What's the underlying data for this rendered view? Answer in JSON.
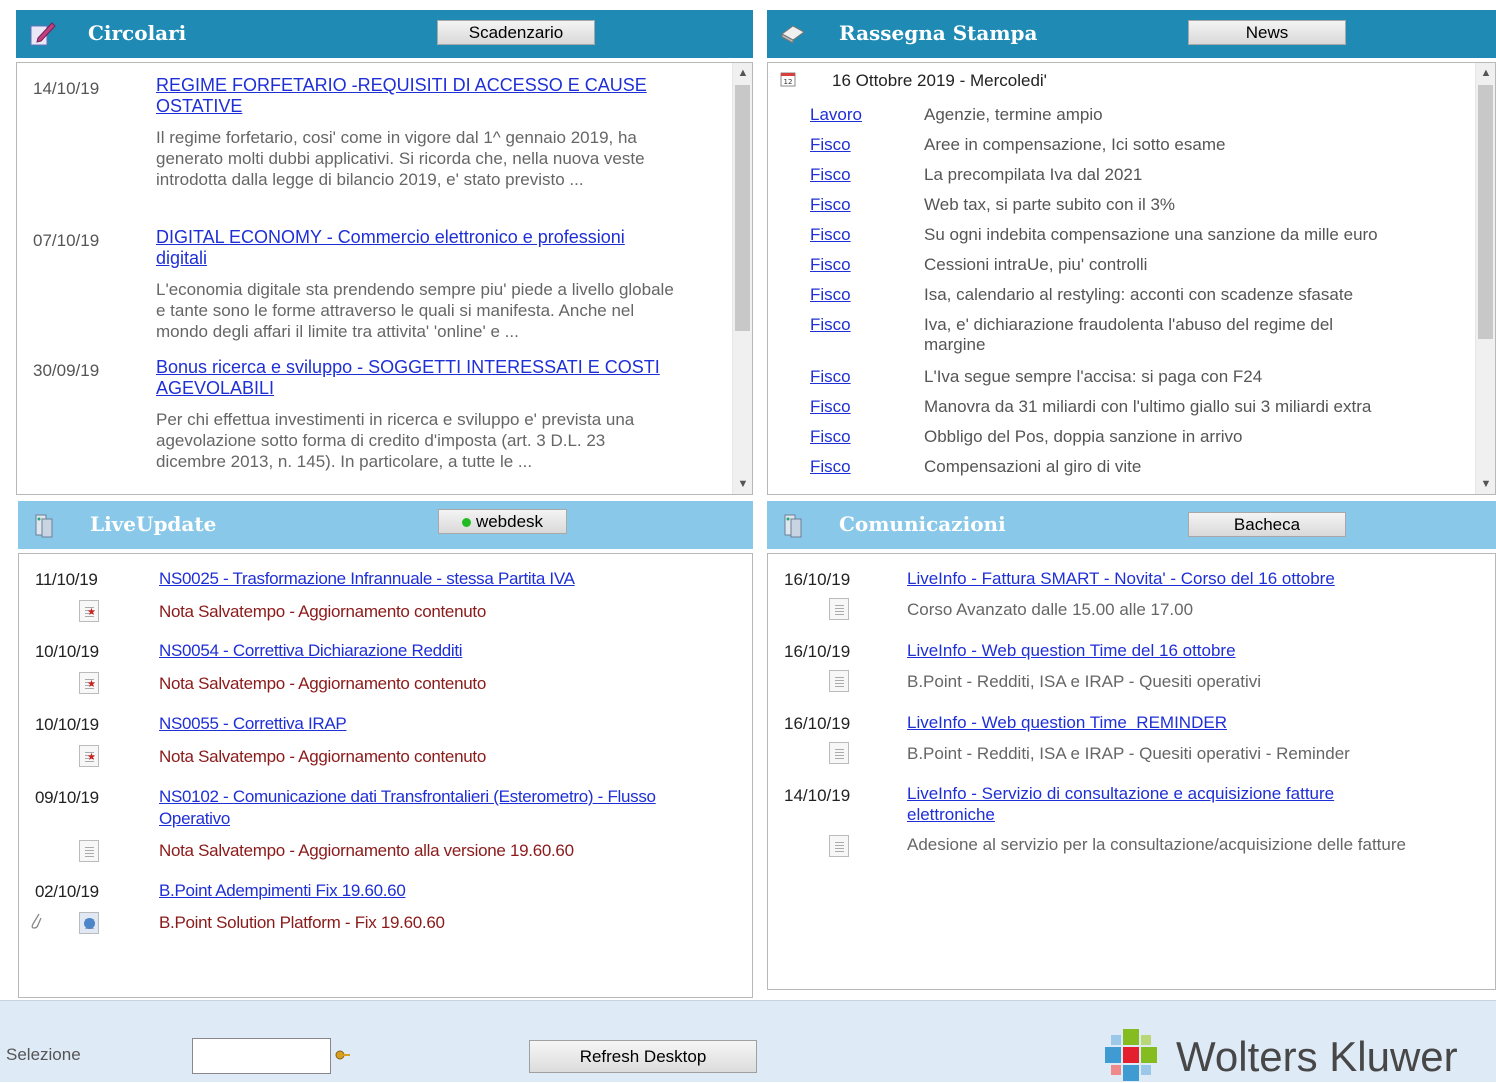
{
  "circolari": {
    "title": "Circolari",
    "button": "Scadenzario",
    "items": [
      {
        "date": "14/10/19",
        "title": "REGIME FORFETARIO -REQUISITI DI ACCESSO E CAUSE OSTATIVE",
        "desc": "Il regime forfetario, cosi' come in vigore dal 1^ gennaio 2019, ha generato molti dubbi applicativi. Si ricorda che, nella nuova veste introdotta dalla legge di bilancio 2019, e' stato previsto ..."
      },
      {
        "date": "07/10/19",
        "title": "DIGITAL ECONOMY - Commercio elettronico e professioni digitali",
        "desc": "L'economia digitale sta prendendo sempre piu' piede a livello globale e tante sono le forme attraverso le quali si manifesta. Anche nel mondo degli affari il limite tra attivita' 'online' e ..."
      },
      {
        "date": "30/09/19",
        "title": "Bonus ricerca e sviluppo - SOGGETTI INTERESSATI E COSTI AGEVOLABILI",
        "desc": "Per chi effettua investimenti in ricerca e sviluppo e' prevista una agevolazione sotto forma di credito d'imposta (art. 3 D.L. 23 dicembre 2013, n. 145). In particolare, a tutte le ..."
      }
    ]
  },
  "rassegna": {
    "title": "Rassegna Stampa",
    "button": "News",
    "date_heading": "16 Ottobre 2019 - Mercoledi'",
    "items": [
      {
        "cat": "Lavoro",
        "text": "Agenzie, termine ampio"
      },
      {
        "cat": "Fisco",
        "text": "Aree in compensazione, Ici sotto esame"
      },
      {
        "cat": "Fisco",
        "text": "La precompilata Iva dal 2021"
      },
      {
        "cat": "Fisco",
        "text": "Web tax, si parte subito con il 3%"
      },
      {
        "cat": "Fisco",
        "text": "Su ogni indebita compensazione una sanzione da mille euro"
      },
      {
        "cat": "Fisco",
        "text": "Cessioni intraUe, piu' controlli"
      },
      {
        "cat": "Fisco",
        "text": "Isa, calendario al restyling: acconti con scadenze sfasate"
      },
      {
        "cat": "Fisco",
        "text": "Iva, e' dichiarazione fraudolenta l'abuso del regime del margine"
      },
      {
        "cat": "Fisco",
        "text": "L'Iva segue sempre l'accisa: si paga con F24"
      },
      {
        "cat": "Fisco",
        "text": "Manovra da 31 miliardi con l'ultimo giallo sui 3 miliardi extra"
      },
      {
        "cat": "Fisco",
        "text": "Obbligo del Pos, doppia sanzione in arrivo"
      },
      {
        "cat": "Fisco",
        "text": "Compensazioni al giro di vite"
      }
    ]
  },
  "liveupdate": {
    "title": "LiveUpdate",
    "button": "webdesk",
    "status_color": "#22bb22",
    "items": [
      {
        "date": "11/10/19",
        "title": "NS0025 - Trasformazione Infrannuale - stessa Partita IVA",
        "sub": "Nota Salvatempo - Aggiornamento contenuto"
      },
      {
        "date": "10/10/19",
        "title": "NS0054 - Correttiva Dichiarazione Redditi",
        "sub": "Nota Salvatempo - Aggiornamento contenuto"
      },
      {
        "date": "10/10/19",
        "title": "NS0055 - Correttiva IRAP",
        "sub": "Nota Salvatempo - Aggiornamento contenuto"
      },
      {
        "date": "09/10/19",
        "title": "NS0102 - Comunicazione dati Transfrontalieri (Esterometro) - Flusso Operativo",
        "sub": "Nota Salvatempo - Aggiornamento alla versione 19.60.60"
      },
      {
        "date": "02/10/19",
        "title": "B.Point Adempimenti Fix 19.60.60",
        "sub": "B.Point Solution Platform - Fix 19.60.60"
      }
    ]
  },
  "comunicazioni": {
    "title": "Comunicazioni",
    "button": "Bacheca",
    "items": [
      {
        "date": "16/10/19",
        "title": "LiveInfo - Fattura SMART - Novita' - Corso del 16 ottobre",
        "sub": "Corso Avanzato dalle 15.00 alle 17.00"
      },
      {
        "date": "16/10/19",
        "title": "LiveInfo - Web question Time del 16 ottobre",
        "sub": "B.Point - Redditi, ISA e IRAP - Quesiti operativi"
      },
      {
        "date": "16/10/19",
        "title": "LiveInfo - Web question Time  REMINDER",
        "sub": "B.Point - Redditi, ISA e IRAP - Quesiti operativi - Reminder"
      },
      {
        "date": "14/10/19",
        "title": "LiveInfo - Servizio di consultazione e acquisizione fatture elettroniche",
        "sub": "Adesione al servizio per la consultazione/acquisizione delle fatture"
      }
    ]
  },
  "footer": {
    "selection_label": "Selezione",
    "selection_value": "",
    "refresh_label": "Refresh Desktop",
    "brand": "Wolters Kluwer"
  },
  "colors": {
    "header_dark": "#1f8bb5",
    "header_light": "#89c8e8",
    "link": "#1f2fd6",
    "note_red": "#8b1a1a"
  }
}
